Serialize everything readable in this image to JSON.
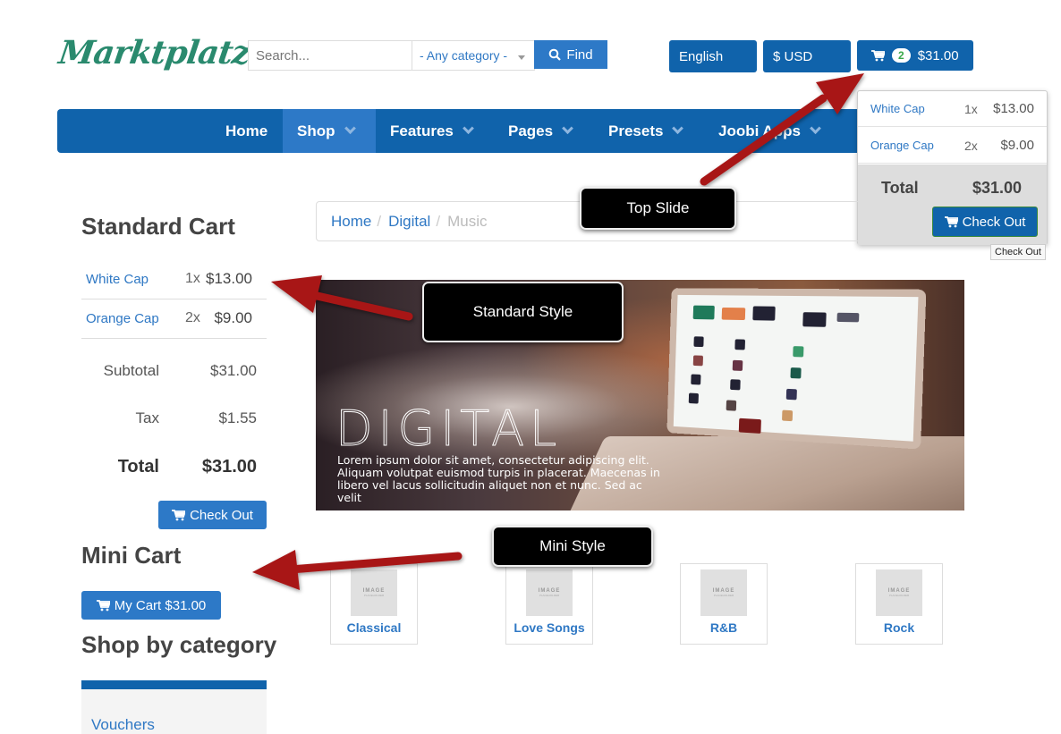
{
  "header": {
    "logo": "Marktplatz",
    "search": {
      "placeholder": "Search...",
      "value": ""
    },
    "category_select": {
      "selected": "- Any category -"
    },
    "find_label": "Find",
    "language": "English",
    "currency": "$ USD",
    "cart": {
      "count": "2",
      "total": "$31.00"
    }
  },
  "nav": {
    "items": [
      {
        "label": "Home",
        "has_dropdown": false,
        "active": false
      },
      {
        "label": "Shop",
        "has_dropdown": true,
        "active": true
      },
      {
        "label": "Features",
        "has_dropdown": true,
        "active": false
      },
      {
        "label": "Pages",
        "has_dropdown": true,
        "active": false
      },
      {
        "label": "Presets",
        "has_dropdown": true,
        "active": false
      },
      {
        "label": "Joobi Apps",
        "has_dropdown": true,
        "active": false
      }
    ]
  },
  "cart_dropdown": {
    "items": [
      {
        "name": "White Cap",
        "qty": "1x",
        "price": "$13.00"
      },
      {
        "name": "Orange Cap",
        "qty": "2x",
        "price": "$9.00"
      }
    ],
    "total_label": "Total",
    "total": "$31.00",
    "checkout_label": "Check Out",
    "tooltip": "Check Out"
  },
  "annotations": {
    "top_slide": "Top Slide",
    "standard_style": "Standard Style",
    "mini_style": "Mini Style",
    "arrow_color": "#a81618"
  },
  "standard_cart": {
    "title": "Standard Cart",
    "items": [
      {
        "name": "White Cap",
        "qty": "1x",
        "price": "$13.00"
      },
      {
        "name": "Orange Cap",
        "qty": "2x",
        "price": "$9.00"
      }
    ],
    "subtotal_label": "Subtotal",
    "subtotal": "$31.00",
    "tax_label": "Tax",
    "tax": "$1.55",
    "total_label": "Total",
    "total": "$31.00",
    "checkout_label": "Check Out"
  },
  "mini_cart": {
    "title": "Mini Cart",
    "button_label": "My Cart $31.00"
  },
  "shop_by_category": {
    "title": "Shop by category",
    "items": [
      "Vouchers"
    ]
  },
  "breadcrumb": {
    "items": [
      {
        "label": "Home",
        "link": true
      },
      {
        "label": "Digital",
        "link": true
      },
      {
        "label": "Music",
        "link": false
      }
    ],
    "separator": "/"
  },
  "banner": {
    "title": "DIGITAL",
    "text": "Lorem ipsum dolor sit amet, consectetur adipiscing elit. Aliquam volutpat euismod turpis in placerat. Maecenas in libero vel lacus sollicitudin aliquet non et nunc. Sed ac velit"
  },
  "categories": {
    "placeholder_text": "IMAGE",
    "placeholder_sub": "PLACEHOLDER",
    "items": [
      "Classical",
      "Love Songs",
      "R&B",
      "Rock"
    ]
  },
  "colors": {
    "primary": "#1063ab",
    "primary_light": "#2d79c7",
    "link": "#2f78c4",
    "logo": "#2a8a6e",
    "badge_text": "#39a84a"
  }
}
